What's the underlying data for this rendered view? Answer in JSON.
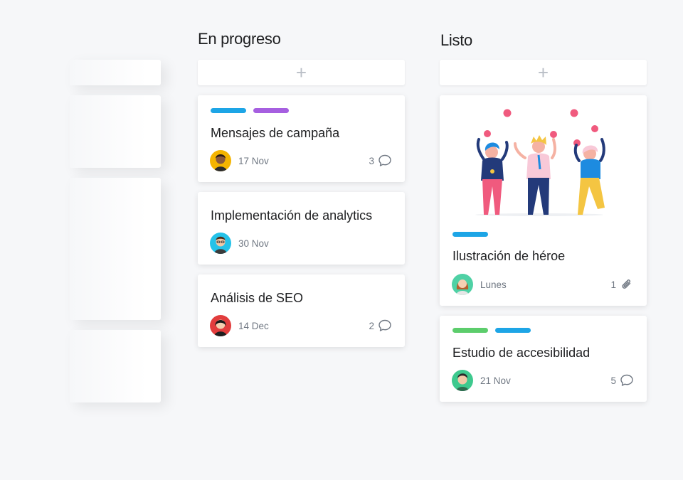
{
  "columns": [
    {
      "title": "En progreso",
      "add_label": "+",
      "cards": [
        {
          "title": "Mensajes de campaña",
          "date": "17 Nov",
          "count": "3",
          "count_icon": "comment-icon",
          "tags": [
            "#1da5e6",
            "#a65fe0"
          ],
          "avatar_color": "#f4b400"
        },
        {
          "title": "Implementación de analytics",
          "date": "30 Nov",
          "count": "",
          "count_icon": "",
          "tags": [],
          "avatar_color": "#25c2e8"
        },
        {
          "title": "Análisis de SEO",
          "date": "14 Dec",
          "count": "2",
          "count_icon": "comment-icon",
          "tags": [],
          "avatar_color": "#e23d3d"
        }
      ]
    },
    {
      "title": "Listo",
      "add_label": "+",
      "cards": [
        {
          "title": "Ilustración de héroe",
          "date": "Lunes",
          "count": "1",
          "count_icon": "paperclip-icon",
          "tags": [
            "#1da5e6"
          ],
          "avatar_color": "#4fd1a5",
          "has_illustration": true
        },
        {
          "title": "Estudio de accesibilidad",
          "date": "21 Nov",
          "count": "5",
          "count_icon": "comment-icon",
          "tags": [
            "#5ccd6c",
            "#1da5e6"
          ],
          "avatar_color": "#3ec98e"
        }
      ]
    }
  ],
  "colors": {
    "background": "#f6f7f9",
    "blue_tag": "#1da5e6",
    "purple_tag": "#a65fe0",
    "green_tag": "#5ccd6c",
    "muted_text": "#6f7782"
  }
}
